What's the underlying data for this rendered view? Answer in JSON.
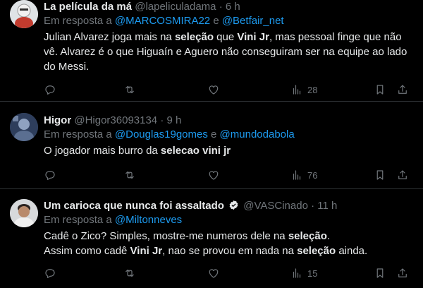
{
  "tweets": [
    {
      "name": "La película da má",
      "handle": "@lapeliculadama",
      "time": "6 h",
      "reply_prefix": "Em resposta a",
      "reply_users": [
        "@MARCOSMIRA22",
        "@Betfair_net"
      ],
      "reply_join": "e",
      "text_parts": [
        {
          "t": "Julian Alvarez joga mais na ",
          "b": false
        },
        {
          "t": "seleção",
          "b": true
        },
        {
          "t": " que ",
          "b": false
        },
        {
          "t": "Vini Jr",
          "b": true
        },
        {
          "t": ", mas pessoal finge que não vê. Alvarez é o que Higuaín e Aguero não conseguiram ser na equipe ao lado do Messi.",
          "b": false
        }
      ],
      "views": "28"
    },
    {
      "name": "Higor",
      "handle": "@Higor36093134",
      "time": "9 h",
      "reply_prefix": "Em resposta a",
      "reply_users": [
        "@Douglas19gomes",
        "@mundodabola"
      ],
      "reply_join": "e",
      "text_parts": [
        {
          "t": "O jogador mais burro da ",
          "b": false
        },
        {
          "t": "selecao vini jr",
          "b": true
        }
      ],
      "views": "76"
    },
    {
      "name": "Um carioca que nunca foi assaltado",
      "handle": "@VASCinado",
      "time": "11 h",
      "reply_prefix": "Em resposta a",
      "reply_users": [
        "@Miltonneves"
      ],
      "reply_join": "",
      "text_parts": [
        {
          "t": "Cadê o Zico? Simples, mostre-me numeros dele na ",
          "b": false
        },
        {
          "t": "seleção",
          "b": true
        },
        {
          "t": ".",
          "b": false,
          "br": true
        },
        {
          "t": "Assim como cadê ",
          "b": false
        },
        {
          "t": "Vini Jr",
          "b": true
        },
        {
          "t": ", nao se provou em nada na ",
          "b": false
        },
        {
          "t": "seleção",
          "b": true
        },
        {
          "t": " ainda.",
          "b": false
        }
      ],
      "views": "15"
    }
  ],
  "separator": "·",
  "colors": {
    "link": "#1d9bf0",
    "muted": "#71767b",
    "text": "#e7e9ea",
    "border": "#2f3336"
  }
}
